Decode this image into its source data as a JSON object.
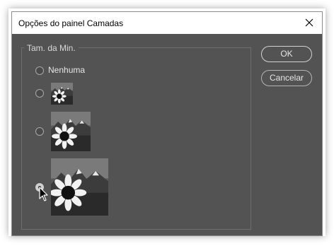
{
  "dialog": {
    "title": "Opções do painel Camadas"
  },
  "thumbnail_size": {
    "legend": "Tam. da Min.",
    "options": [
      {
        "label": "Nenhuma",
        "selected": false,
        "has_thumbnail": false
      },
      {
        "label": "",
        "selected": false,
        "has_thumbnail": true,
        "size": "small"
      },
      {
        "label": "",
        "selected": false,
        "has_thumbnail": true,
        "size": "medium"
      },
      {
        "label": "",
        "selected": true,
        "has_thumbnail": true,
        "size": "large"
      }
    ]
  },
  "buttons": {
    "ok_label": "OK",
    "cancel_label": "Cancelar"
  },
  "colors": {
    "dialog_bg": "#535353",
    "titlebar_bg": "#ffffff",
    "text": "#e6e6e6"
  },
  "icons": {
    "close": "close-icon",
    "thumbnail_image": "sunflower-mountain-image",
    "cursor": "mouse-pointer-icon"
  }
}
